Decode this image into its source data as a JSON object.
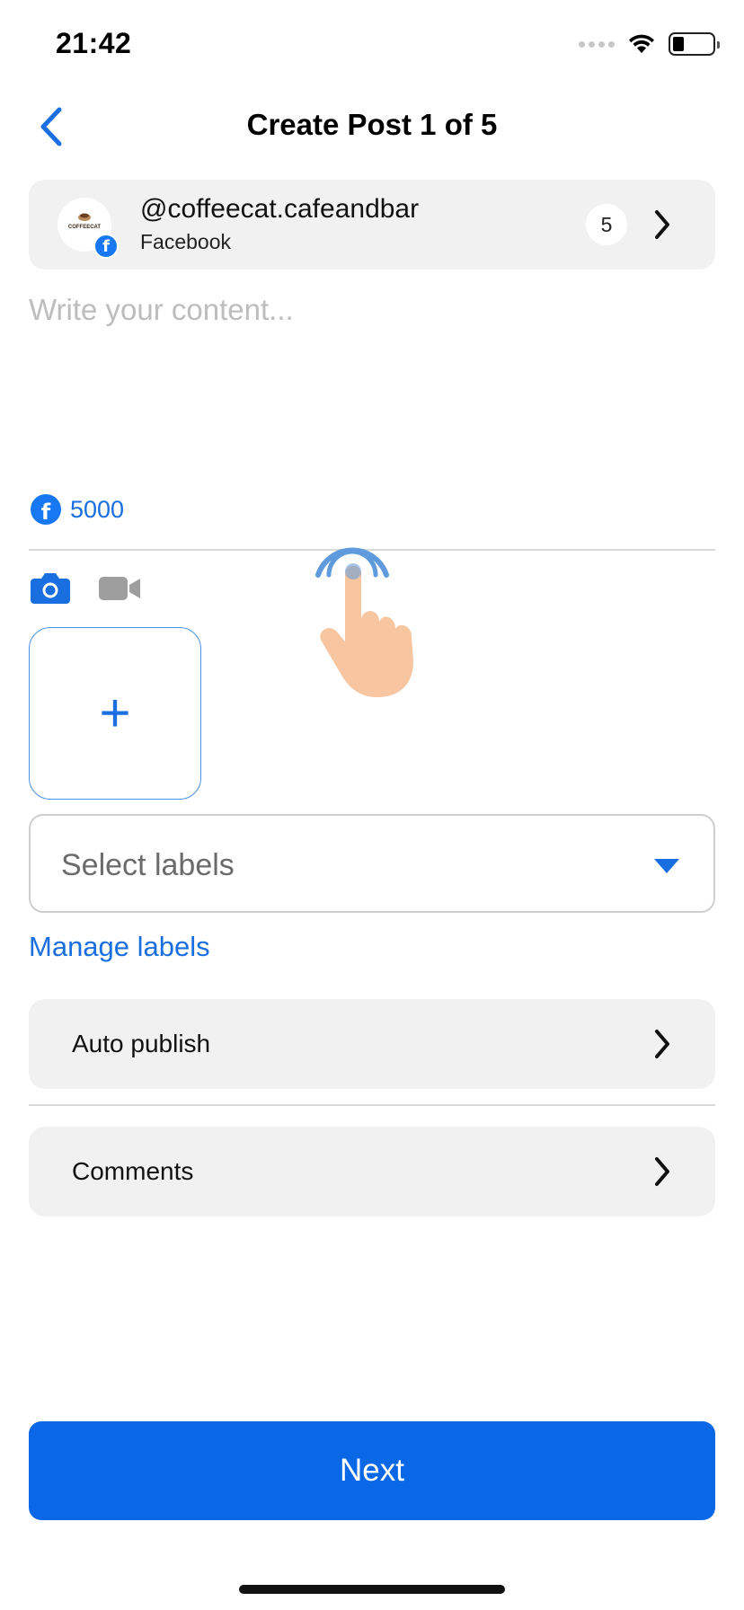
{
  "status_bar": {
    "time": "21:42"
  },
  "nav": {
    "title": "Create Post 1 of 5"
  },
  "account": {
    "handle": "@coffeecat.cafeandbar",
    "platform": "Facebook",
    "count": "5",
    "logo_text": "COFFEECAT"
  },
  "content": {
    "placeholder": "Write your content..."
  },
  "char_counter": {
    "value": "5000"
  },
  "labels": {
    "select_placeholder": "Select labels",
    "manage_link": "Manage labels"
  },
  "settings": {
    "auto_publish": "Auto publish",
    "comments": "Comments"
  },
  "actions": {
    "next_label": "Next"
  },
  "icons": {
    "back": "chevron-left-icon",
    "camera": "camera-icon",
    "video": "video-camera-icon",
    "facebook": "facebook-icon",
    "add": "plus-icon",
    "caret": "caret-down-icon",
    "tap": "tap-gesture-hand-icon"
  },
  "colors": {
    "accent": "#1a6fe0",
    "button": "#0a68e6",
    "card_bg": "#f1f1f1",
    "facebook": "#1877f2"
  }
}
